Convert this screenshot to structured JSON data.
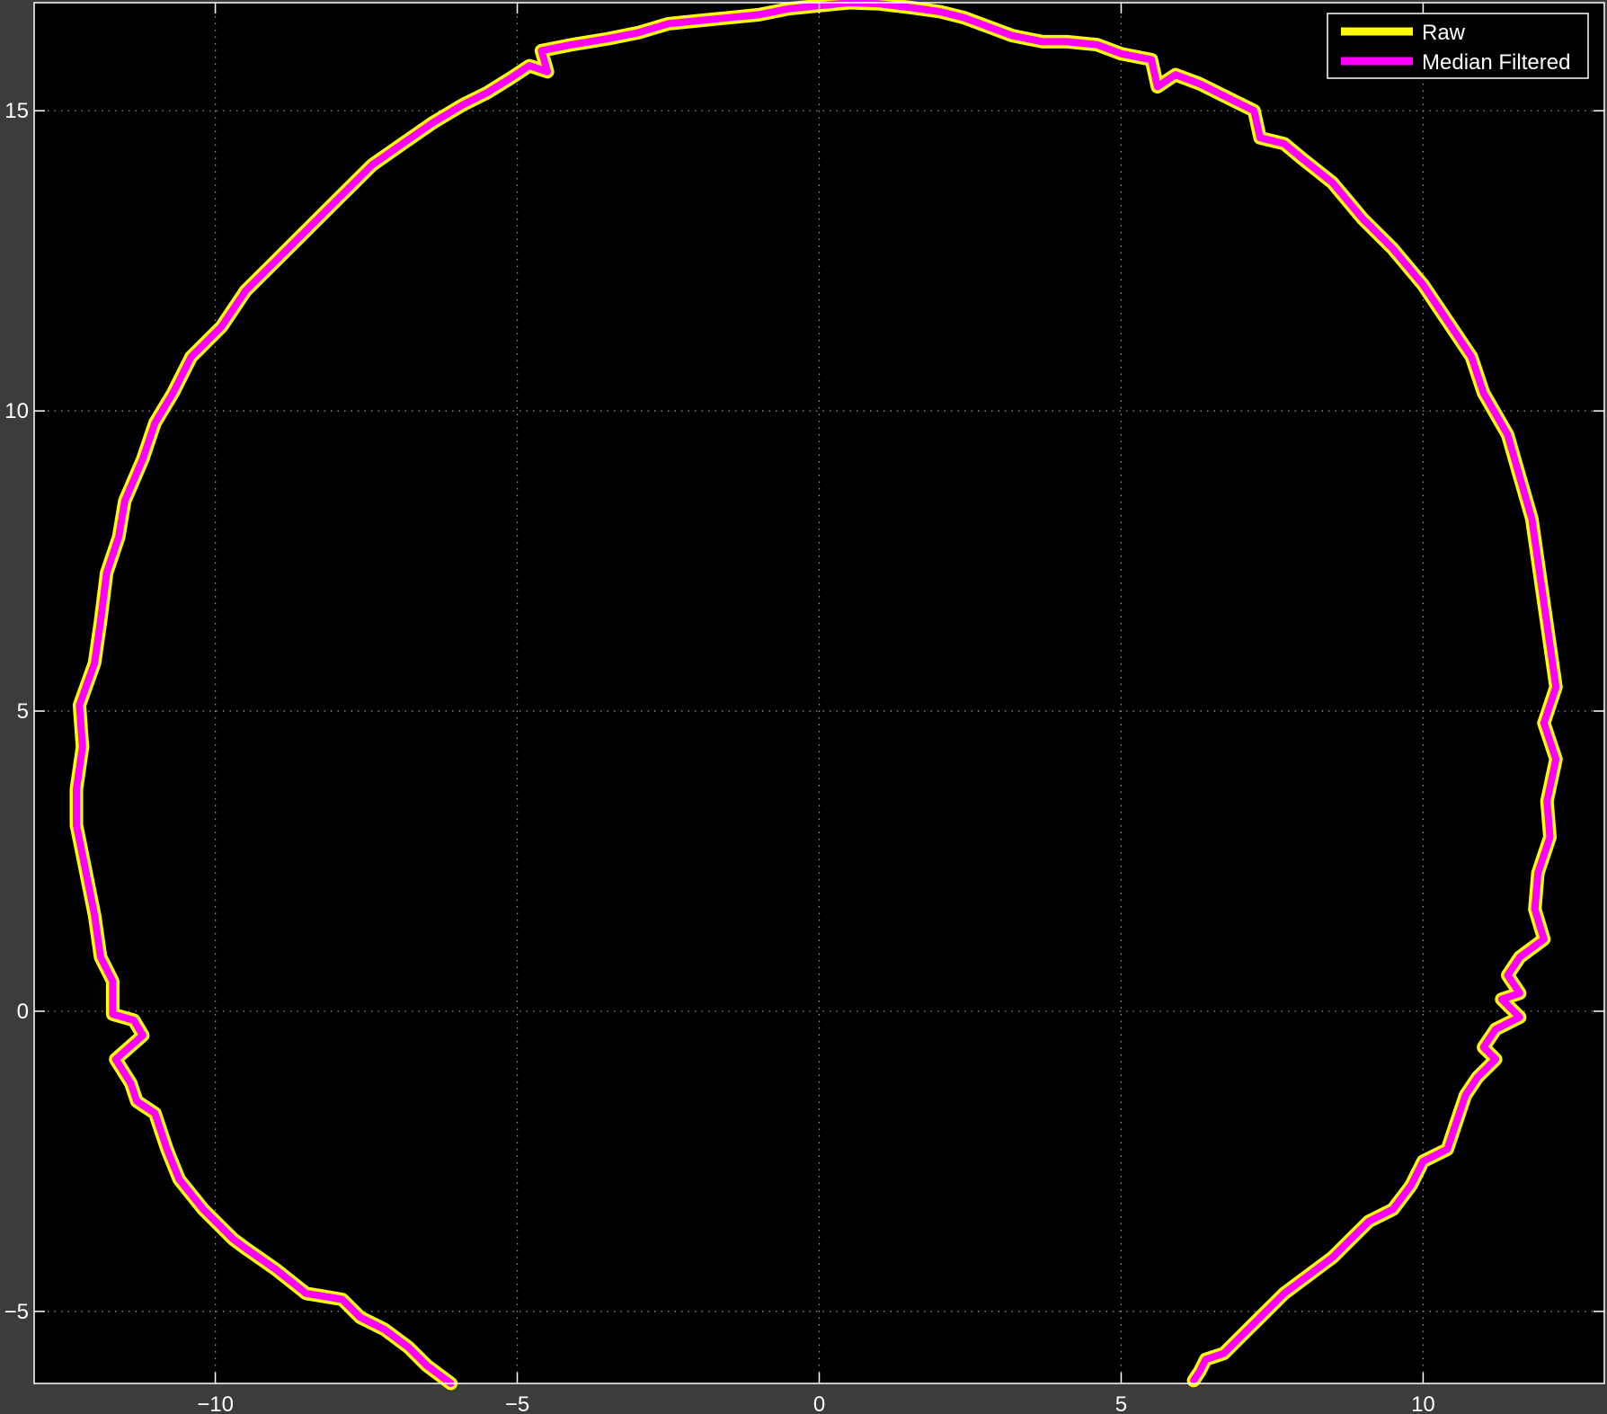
{
  "colors": {
    "figure_background": "#3c3c3c",
    "axes_background": "#000000",
    "axes_color": "#ffffff",
    "grid_color": "#9a9a9a"
  },
  "chart_data": {
    "type": "line",
    "title": "",
    "xlabel": "",
    "ylabel": "",
    "xlim": [
      -13,
      13
    ],
    "ylim": [
      -6.2,
      16.8
    ],
    "xticks": [
      -10,
      -5,
      0,
      5,
      10
    ],
    "xtick_labels": [
      "−10",
      "−5",
      "0",
      "5",
      "10"
    ],
    "yticks": [
      -5,
      0,
      5,
      10,
      15
    ],
    "ytick_labels": [
      "−5",
      "0",
      "5",
      "10",
      "15"
    ],
    "grid": true,
    "legend_position": "top-right",
    "series": [
      {
        "name": "Raw",
        "color": "#ffff00",
        "points": [
          [
            -6.1,
            -6.2
          ],
          [
            -6.5,
            -5.9
          ],
          [
            -6.8,
            -5.6
          ],
          [
            -7.2,
            -5.3
          ],
          [
            -7.6,
            -5.1
          ],
          [
            -7.9,
            -4.8
          ],
          [
            -8.5,
            -4.7
          ],
          [
            -9.0,
            -4.3
          ],
          [
            -9.5,
            -3.95
          ],
          [
            -9.7,
            -3.8
          ],
          [
            -10.2,
            -3.3
          ],
          [
            -10.6,
            -2.8
          ],
          [
            -10.8,
            -2.3
          ],
          [
            -11.0,
            -1.7
          ],
          [
            -11.3,
            -1.5
          ],
          [
            -11.4,
            -1.2
          ],
          [
            -11.65,
            -0.8
          ],
          [
            -11.2,
            -0.4
          ],
          [
            -11.35,
            -0.15
          ],
          [
            -11.7,
            -0.05
          ],
          [
            -11.7,
            0.5
          ],
          [
            -11.9,
            0.9
          ],
          [
            -12.0,
            1.6
          ],
          [
            -12.1,
            2.1
          ],
          [
            -12.2,
            2.6
          ],
          [
            -12.3,
            3.1
          ],
          [
            -12.3,
            3.7
          ],
          [
            -12.2,
            4.4
          ],
          [
            -12.25,
            5.1
          ],
          [
            -12.0,
            5.8
          ],
          [
            -11.9,
            6.5
          ],
          [
            -11.8,
            7.3
          ],
          [
            -11.6,
            7.9
          ],
          [
            -11.5,
            8.5
          ],
          [
            -11.2,
            9.2
          ],
          [
            -11.0,
            9.8
          ],
          [
            -10.7,
            10.3
          ],
          [
            -10.4,
            10.9
          ],
          [
            -9.9,
            11.4
          ],
          [
            -9.5,
            12.0
          ],
          [
            -9.0,
            12.5
          ],
          [
            -8.6,
            12.9
          ],
          [
            -8.2,
            13.3
          ],
          [
            -7.8,
            13.7
          ],
          [
            -7.4,
            14.1
          ],
          [
            -6.9,
            14.45
          ],
          [
            -6.4,
            14.8
          ],
          [
            -5.9,
            15.1
          ],
          [
            -5.5,
            15.3
          ],
          [
            -5.1,
            15.55
          ],
          [
            -4.8,
            15.75
          ],
          [
            -4.5,
            15.65
          ],
          [
            -4.6,
            16.0
          ],
          [
            -4.1,
            16.1
          ],
          [
            -3.5,
            16.2
          ],
          [
            -3.0,
            16.3
          ],
          [
            -2.5,
            16.45
          ],
          [
            -2.0,
            16.5
          ],
          [
            -1.5,
            16.55
          ],
          [
            -1.0,
            16.6
          ],
          [
            -0.5,
            16.7
          ],
          [
            0.0,
            16.75
          ],
          [
            0.5,
            16.8
          ],
          [
            1.0,
            16.78
          ],
          [
            1.5,
            16.72
          ],
          [
            2.0,
            16.65
          ],
          [
            2.4,
            16.55
          ],
          [
            2.8,
            16.4
          ],
          [
            3.2,
            16.25
          ],
          [
            3.7,
            16.15
          ],
          [
            4.1,
            16.15
          ],
          [
            4.6,
            16.1
          ],
          [
            5.0,
            15.95
          ],
          [
            5.5,
            15.85
          ],
          [
            5.6,
            15.4
          ],
          [
            5.9,
            15.6
          ],
          [
            6.3,
            15.45
          ],
          [
            6.8,
            15.2
          ],
          [
            7.2,
            15.0
          ],
          [
            7.3,
            14.55
          ],
          [
            7.7,
            14.45
          ],
          [
            8.0,
            14.2
          ],
          [
            8.5,
            13.8
          ],
          [
            9.0,
            13.2
          ],
          [
            9.5,
            12.7
          ],
          [
            10.0,
            12.1
          ],
          [
            10.4,
            11.5
          ],
          [
            10.8,
            10.9
          ],
          [
            11.0,
            10.3
          ],
          [
            11.4,
            9.6
          ],
          [
            11.6,
            8.9
          ],
          [
            11.8,
            8.2
          ],
          [
            11.9,
            7.5
          ],
          [
            12.0,
            6.8
          ],
          [
            12.1,
            6.1
          ],
          [
            12.2,
            5.4
          ],
          [
            12.0,
            4.8
          ],
          [
            12.2,
            4.2
          ],
          [
            12.05,
            3.5
          ],
          [
            12.1,
            2.9
          ],
          [
            11.9,
            2.3
          ],
          [
            11.85,
            1.7
          ],
          [
            12.0,
            1.2
          ],
          [
            11.6,
            0.9
          ],
          [
            11.4,
            0.6
          ],
          [
            11.6,
            0.3
          ],
          [
            11.3,
            0.2
          ],
          [
            11.6,
            -0.1
          ],
          [
            11.2,
            -0.3
          ],
          [
            11.0,
            -0.6
          ],
          [
            11.2,
            -0.8
          ],
          [
            10.9,
            -1.1
          ],
          [
            10.7,
            -1.4
          ],
          [
            10.6,
            -1.7
          ],
          [
            10.5,
            -2.0
          ],
          [
            10.4,
            -2.3
          ],
          [
            10.0,
            -2.5
          ],
          [
            9.8,
            -2.9
          ],
          [
            9.5,
            -3.3
          ],
          [
            9.1,
            -3.5
          ],
          [
            8.8,
            -3.8
          ],
          [
            8.5,
            -4.1
          ],
          [
            8.1,
            -4.4
          ],
          [
            7.7,
            -4.7
          ],
          [
            7.3,
            -5.1
          ],
          [
            7.0,
            -5.4
          ],
          [
            6.7,
            -5.7
          ],
          [
            6.4,
            -5.8
          ],
          [
            6.3,
            -6.0
          ],
          [
            6.2,
            -6.15
          ]
        ]
      },
      {
        "name": "Median Filtered",
        "color": "#ff00ff",
        "points": [
          [
            -6.1,
            -6.2
          ],
          [
            -6.5,
            -5.9
          ],
          [
            -6.8,
            -5.6
          ],
          [
            -7.2,
            -5.3
          ],
          [
            -7.6,
            -5.1
          ],
          [
            -7.9,
            -4.8
          ],
          [
            -8.5,
            -4.7
          ],
          [
            -9.0,
            -4.3
          ],
          [
            -9.5,
            -3.95
          ],
          [
            -9.7,
            -3.8
          ],
          [
            -10.2,
            -3.3
          ],
          [
            -10.6,
            -2.8
          ],
          [
            -10.8,
            -2.3
          ],
          [
            -11.0,
            -1.7
          ],
          [
            -11.3,
            -1.5
          ],
          [
            -11.4,
            -1.2
          ],
          [
            -11.65,
            -0.8
          ],
          [
            -11.2,
            -0.4
          ],
          [
            -11.35,
            -0.15
          ],
          [
            -11.7,
            -0.05
          ],
          [
            -11.7,
            0.5
          ],
          [
            -11.9,
            0.9
          ],
          [
            -12.0,
            1.6
          ],
          [
            -12.1,
            2.1
          ],
          [
            -12.2,
            2.6
          ],
          [
            -12.3,
            3.1
          ],
          [
            -12.3,
            3.7
          ],
          [
            -12.2,
            4.4
          ],
          [
            -12.25,
            5.1
          ],
          [
            -12.0,
            5.8
          ],
          [
            -11.9,
            6.5
          ],
          [
            -11.8,
            7.3
          ],
          [
            -11.6,
            7.9
          ],
          [
            -11.5,
            8.5
          ],
          [
            -11.2,
            9.2
          ],
          [
            -11.0,
            9.8
          ],
          [
            -10.7,
            10.3
          ],
          [
            -10.4,
            10.9
          ],
          [
            -9.9,
            11.4
          ],
          [
            -9.5,
            12.0
          ],
          [
            -9.0,
            12.5
          ],
          [
            -8.6,
            12.9
          ],
          [
            -8.2,
            13.3
          ],
          [
            -7.8,
            13.7
          ],
          [
            -7.4,
            14.1
          ],
          [
            -6.9,
            14.45
          ],
          [
            -6.4,
            14.8
          ],
          [
            -5.9,
            15.1
          ],
          [
            -5.5,
            15.3
          ],
          [
            -5.1,
            15.55
          ],
          [
            -4.8,
            15.75
          ],
          [
            -4.5,
            15.65
          ],
          [
            -4.6,
            16.0
          ],
          [
            -4.1,
            16.1
          ],
          [
            -3.5,
            16.2
          ],
          [
            -3.0,
            16.3
          ],
          [
            -2.5,
            16.45
          ],
          [
            -2.0,
            16.5
          ],
          [
            -1.5,
            16.55
          ],
          [
            -1.0,
            16.6
          ],
          [
            -0.5,
            16.7
          ],
          [
            0.0,
            16.75
          ],
          [
            0.5,
            16.8
          ],
          [
            1.0,
            16.78
          ],
          [
            1.5,
            16.72
          ],
          [
            2.0,
            16.65
          ],
          [
            2.4,
            16.55
          ],
          [
            2.8,
            16.4
          ],
          [
            3.2,
            16.25
          ],
          [
            3.7,
            16.15
          ],
          [
            4.1,
            16.15
          ],
          [
            4.6,
            16.1
          ],
          [
            5.0,
            15.95
          ],
          [
            5.5,
            15.85
          ],
          [
            5.6,
            15.4
          ],
          [
            5.9,
            15.6
          ],
          [
            6.3,
            15.45
          ],
          [
            6.8,
            15.2
          ],
          [
            7.2,
            15.0
          ],
          [
            7.3,
            14.55
          ],
          [
            7.7,
            14.45
          ],
          [
            8.0,
            14.2
          ],
          [
            8.5,
            13.8
          ],
          [
            9.0,
            13.2
          ],
          [
            9.5,
            12.7
          ],
          [
            10.0,
            12.1
          ],
          [
            10.4,
            11.5
          ],
          [
            10.8,
            10.9
          ],
          [
            11.0,
            10.3
          ],
          [
            11.4,
            9.6
          ],
          [
            11.6,
            8.9
          ],
          [
            11.8,
            8.2
          ],
          [
            11.9,
            7.5
          ],
          [
            12.0,
            6.8
          ],
          [
            12.1,
            6.1
          ],
          [
            12.2,
            5.4
          ],
          [
            12.0,
            4.8
          ],
          [
            12.2,
            4.2
          ],
          [
            12.05,
            3.5
          ],
          [
            12.1,
            2.9
          ],
          [
            11.9,
            2.3
          ],
          [
            11.85,
            1.7
          ],
          [
            12.0,
            1.2
          ],
          [
            11.6,
            0.9
          ],
          [
            11.4,
            0.6
          ],
          [
            11.6,
            0.3
          ],
          [
            11.3,
            0.2
          ],
          [
            11.6,
            -0.1
          ],
          [
            11.2,
            -0.3
          ],
          [
            11.0,
            -0.6
          ],
          [
            11.2,
            -0.8
          ],
          [
            10.9,
            -1.1
          ],
          [
            10.7,
            -1.4
          ],
          [
            10.6,
            -1.7
          ],
          [
            10.5,
            -2.0
          ],
          [
            10.4,
            -2.3
          ],
          [
            10.0,
            -2.5
          ],
          [
            9.8,
            -2.9
          ],
          [
            9.5,
            -3.3
          ],
          [
            9.1,
            -3.5
          ],
          [
            8.8,
            -3.8
          ],
          [
            8.5,
            -4.1
          ],
          [
            8.1,
            -4.4
          ],
          [
            7.7,
            -4.7
          ],
          [
            7.3,
            -5.1
          ],
          [
            7.0,
            -5.4
          ],
          [
            6.7,
            -5.7
          ],
          [
            6.4,
            -5.8
          ],
          [
            6.3,
            -6.0
          ],
          [
            6.2,
            -6.15
          ]
        ]
      }
    ]
  }
}
